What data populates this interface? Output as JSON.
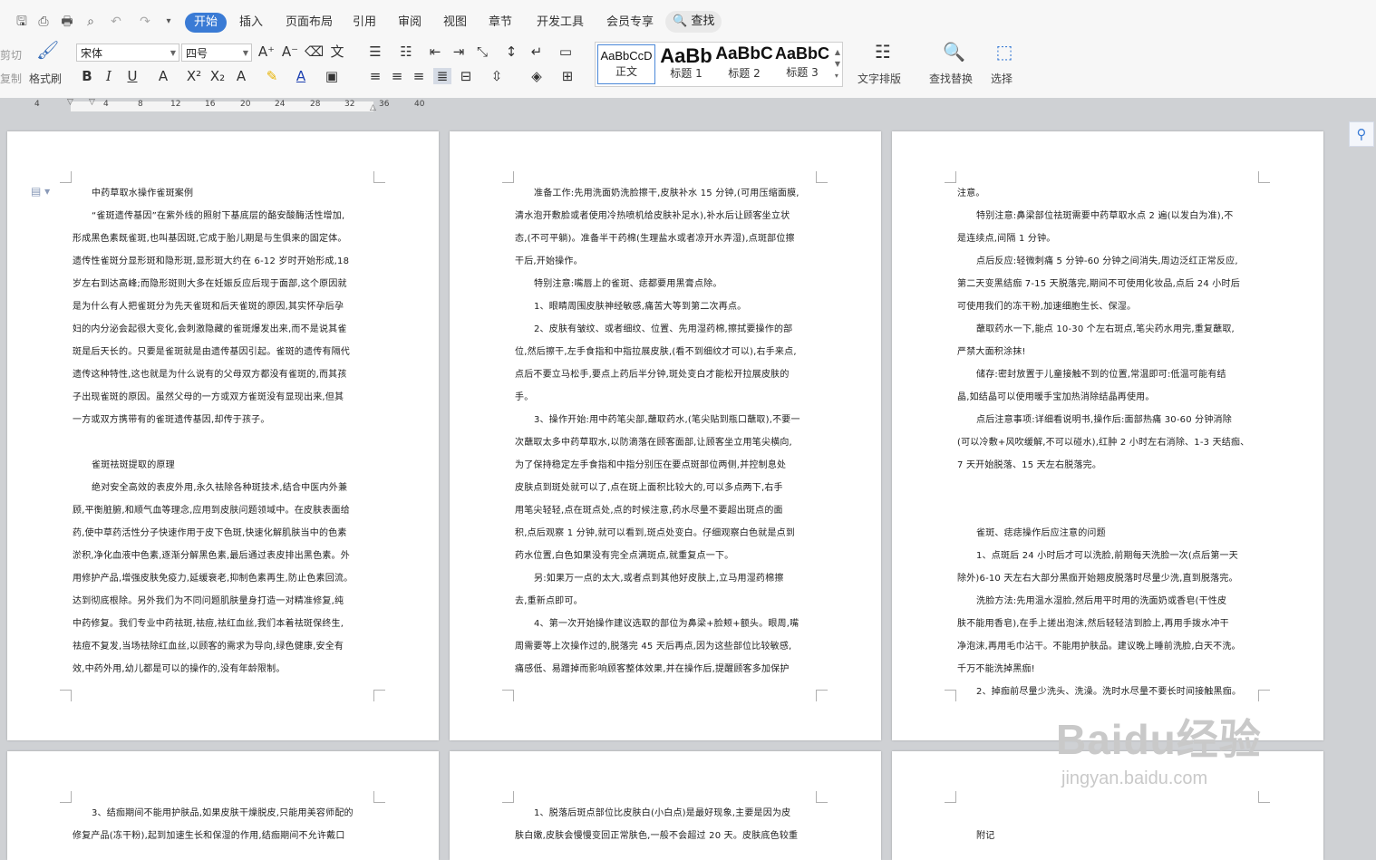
{
  "menu": {
    "tabs": [
      "开始",
      "插入",
      "页面布局",
      "引用",
      "审阅",
      "视图",
      "章节",
      "开发工具",
      "会员专享"
    ],
    "search": "查找"
  },
  "ribbon": {
    "cut": "剪切",
    "copy": "复制",
    "format_painter": "格式刷",
    "font_name": "宋体",
    "font_size": "四号",
    "styles": [
      {
        "preview": "AaBbCcD",
        "name": "正文"
      },
      {
        "preview": "AaBb",
        "name": "标题 1"
      },
      {
        "preview": "AaBbC",
        "name": "标题 2"
      },
      {
        "preview": "AaBbC",
        "name": "标题 3"
      }
    ],
    "text_layout": "文字排版",
    "find_replace": "查找替换",
    "select": "选择"
  },
  "ruler": {
    "labels": [
      "4",
      "4",
      "8",
      "12",
      "16",
      "20",
      "24",
      "28",
      "32",
      "36",
      "40"
    ]
  },
  "pages": {
    "p1": [
      "中药草取水操作雀斑案例",
      "“雀斑遗传基因”在紫外线的照射下基底层的酪安酸酶活性增加,",
      "形成黑色素既雀斑,也叫基因斑,它成于胎儿期是与生俱来的固定体。",
      "遗传性雀斑分显形斑和隐形斑,显形斑大约在 6-12 岁时开始形成,18",
      "岁左右到达高峰;而隐形斑则大多在妊娠反应后现于面部,这个原因就",
      "是为什么有人把雀斑分为先天雀斑和后天雀斑的原因,其实怀孕后孕",
      "妇的内分泌会起很大变化,会刺激隐藏的雀斑爆发出来,而不是说其雀",
      "斑是后天长的。只要是雀斑就是由遗传基因引起。雀斑的遗传有隔代",
      "遗传这种特性,这也就是为什么说有的父母双方都没有雀斑的,而其孩",
      "子出现雀斑的原因。虽然父母的一方或双方雀斑没有显现出来,但其",
      "一方或双方携带有的雀斑遗传基因,却传于孩子。",
      "",
      "雀斑祛斑提取的原理",
      "绝对安全高效的表皮外用,永久祛除各种斑技术,结合中医内外兼",
      "顾,平衡脏腑,和顺气血等理念,应用到皮肤问题领域中。在皮肤表面给",
      "药,使中草药活性分子快速作用于皮下色斑,快速化解肌肤当中的色素",
      "淤积,净化血液中色素,逐渐分解黑色素,最后通过表皮排出黑色素。外",
      "用修护产品,增强皮肤免疫力,延缓衰老,抑制色素再生,防止色素回流。",
      "达到彻底根除。另外我们为不同问题肌肤量身打造一对精准修复,纯",
      "中药修复。我们专业中药祛斑,祛痘,祛红血丝,我们本着祛斑保终生,",
      "祛痘不复发,当场祛除红血丝,以顾客的需求为导向,绿色健康,安全有",
      "效,中药外用,幼儿都是可以的操作的,没有年龄限制。"
    ],
    "p2": [
      "准备工作:先用洗面奶洗脸擦干,皮肤补水 15 分钟,(可用压缩面膜,",
      "清水泡开敷脸或者使用冷热喷机给皮肤补足水),补水后让顾客坐立状",
      "态,(不可平躺)。准备半干药棉(生理盐水或者凉开水弄湿),点斑部位擦",
      "干后,开始操作。",
      "特别注意:嘴唇上的雀斑、痣都要用黑膏点除。",
      "1、眼睛周围皮肤神经敏感,痛苦大等到第二次再点。",
      "2、皮肤有皱纹、或者细纹、位置、先用湿药棉,擦拭要操作的部",
      "位,然后擦干,左手食指和中指拉展皮肤,(看不到细纹才可以),右手来点,",
      "点后不要立马松手,要点上药后半分钟,斑处变白才能松开拉展皮肤的",
      "手。",
      "3、操作开始:用中药笔尖部,蘸取药水,(笔尖贴到瓶口蘸取),不要一",
      "次蘸取太多中药草取水,以防滴落在顾客面部,让顾客坐立用笔尖横向,",
      "为了保持稳定左手食指和中指分别压在要点斑部位两侧,并控制息处",
      "皮肤点到斑处就可以了,点在斑上面积比较大的,可以多点两下,右手",
      "用笔尖轻轻,点在斑点处,点的时候注意,药水尽量不要超出斑点的面",
      "积,点后观察 1 分钟,就可以看到,斑点处变白。仔细观察白色就是点到",
      "药水位置,白色如果没有完全点满斑点,就重复点一下。",
      "另:如果万一点的太大,或者点到其他好皮肤上,立马用湿药棉擦",
      "去,重新点即可。",
      "4、第一次开始操作建议选取的部位为鼻梁+脸颊+额头。眼周,嘴",
      "周需要等上次操作过的,脱落完 45 天后再点,因为这些部位比较敏感,",
      "痛感低、易蹭掉而影响顾客整体效果,并在操作后,提醒顾客多加保护"
    ],
    "p3": [
      "注意。",
      "特别注意:鼻梁部位祛斑需要中药草取水点 2 遍(以发白为准),不",
      "是连续点,间隔 1 分钟。",
      "点后反应:轻微刺痛 5 分钟-60 分钟之间消失,周边泛红正常反应,",
      "第二天变黑结痂 7-15 天脱落完,期间不可使用化妆品,点后 24 小时后",
      "可使用我们的冻干粉,加速细胞生长、保湿。",
      "蘸取药水一下,能点 10-30 个左右斑点,笔尖药水用完,重复蘸取,",
      "严禁大面积涂抹!",
      "储存:密封放置于儿童接触不到的位置,常温即可:低温可能有结",
      "晶,如结晶可以使用暖手宝加热消除结晶再使用。",
      "点后注意事项:详细看说明书,操作后:面部热痛 30-60 分钟消除",
      "(可以冷敷+风吹缓解,不可以碰水),红肿 2 小时左右消除、1-3 天结痂、",
      "7 天开始脱落、15 天左右脱落完。",
      "",
      "",
      "雀斑、痣痣操作后应注意的问题",
      "1、点斑后 24 小时后才可以洗脸,前期每天洗脸一次(点后第一天",
      "除外)6-10 天左右大部分黑痂开始翘皮脱落时尽量少洗,直到脱落完。",
      "洗脸方法:先用温水湿脸,然后用平时用的洗面奶或香皂(干性皮",
      "肤不能用香皂),在手上搓出泡沫,然后轻轻洁到脸上,再用手拨水冲干",
      "净泡沫,再用毛巾沾干。不能用护肤品。建议晚上睡前洗脸,白天不洗。",
      "千万不能洗掉黑痂!",
      "2、掉痂前尽量少洗头、洗澡。洗时水尽量不要长时间接触黑痂。"
    ],
    "p4": [
      "3、结痂期间不能用护肤品,如果皮肤干燥脱皮,只能用美容师配的",
      "修复产品(冻干粉),起到加速生长和保湿的作用,结痂期间不允许戴口"
    ],
    "p5": [
      "1、脱落后斑点部位比皮肤白(小白点)是最好现象,主要是因为皮",
      "肤白嫩,皮肤会慢慢变回正常肤色,一般不会超过 20 天。皮肤底色较重"
    ],
    "p6": [
      "附记"
    ]
  },
  "watermark": {
    "main": "Baidu经验",
    "sub": "jingyan.baidu.com"
  }
}
